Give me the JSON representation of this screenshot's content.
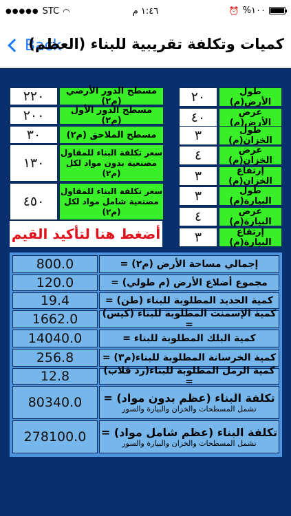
{
  "status_bar": {
    "carrier": "STC",
    "time": "١:٤٦ م",
    "battery": "%١٠٠",
    "battery_level": 1.0
  },
  "nav": {
    "back_label": "Back",
    "title": "كميات وتكلفة تقريبية للبناء (العظم)"
  },
  "left_inputs": [
    {
      "label": "طول الأرض(م)",
      "value": "٢٠"
    },
    {
      "label": "عرض الأرض(م)",
      "value": "٤٠"
    },
    {
      "label": "طول الخزان(م)",
      "value": "٣"
    },
    {
      "label": "عرض الخزان(م)",
      "value": "٤"
    },
    {
      "label": "إرتفاع الخزان(م)",
      "value": "٣"
    },
    {
      "label": "طول البيارة(م)",
      "value": "٣"
    },
    {
      "label": "عرض البيارة(م)",
      "value": "٤"
    },
    {
      "label": "إرتفاع البيارة(م)",
      "value": "٣"
    }
  ],
  "right_inputs": [
    {
      "label": "مسطح الدور الأرضي (م٢)",
      "value": "٢٢٠"
    },
    {
      "label": "مسطح الدور الأول (م٢)",
      "value": "٢٠٠"
    },
    {
      "label": "مسطح الملاحق (م٢)",
      "value": "٣٠"
    },
    {
      "label_line1": "سعر تكلفة البناء للمقاول",
      "label_line2": "مصنعية بدون مواد لكل (م٢)",
      "value": "١٣٠"
    },
    {
      "label_line1": "سعر تكلفة البناء للمقاول",
      "label_line2": "مصنعية شامل مواد لكل (م٢)",
      "value": "٤٥٠"
    }
  ],
  "confirm_button": "أضغط هنا لتأكيد القيم",
  "results": [
    {
      "label": "إجمالي مساحة الأرض (م٢) =",
      "value": "800.0"
    },
    {
      "label": "مجموع أضلاع الأرض (م طولي) =",
      "value": "120.0"
    },
    {
      "label": "كمية الحديد المطلوبة للبناء (طن) =",
      "value": "19.4"
    },
    {
      "label": "كمية الإسمنت المطلوبة للبناء (كيس) =",
      "value": "1662.0"
    },
    {
      "label": "كمية البلك المطلوبة للبناء =",
      "value": "14040.0"
    },
    {
      "label": "كمية الخرسانة المطلوبة للبناء(م٣) =",
      "value": "256.8"
    },
    {
      "label": "كمية الرمل المطلوبة للبناء(رد قلاب) =",
      "value": "12.8"
    },
    {
      "main": "تكلفة البناء (عظم بدون مواد) =",
      "sub": "تشمل المسطحات والخزان والبيارة والسور",
      "value": "80340.0"
    },
    {
      "main": "تكلفة البناء (عظم شامل مواد) =",
      "sub": "تشمل المسطحات والخزان والبيارة والسور",
      "value": "278100.0"
    }
  ],
  "colors": {
    "background": "#082f6e",
    "label_green": "#39ef27",
    "result_blue": "#76b6ea",
    "panel_blue": "#4d94df",
    "button_text_red": "#e0101a",
    "ios_blue": "#1a7cf5"
  }
}
